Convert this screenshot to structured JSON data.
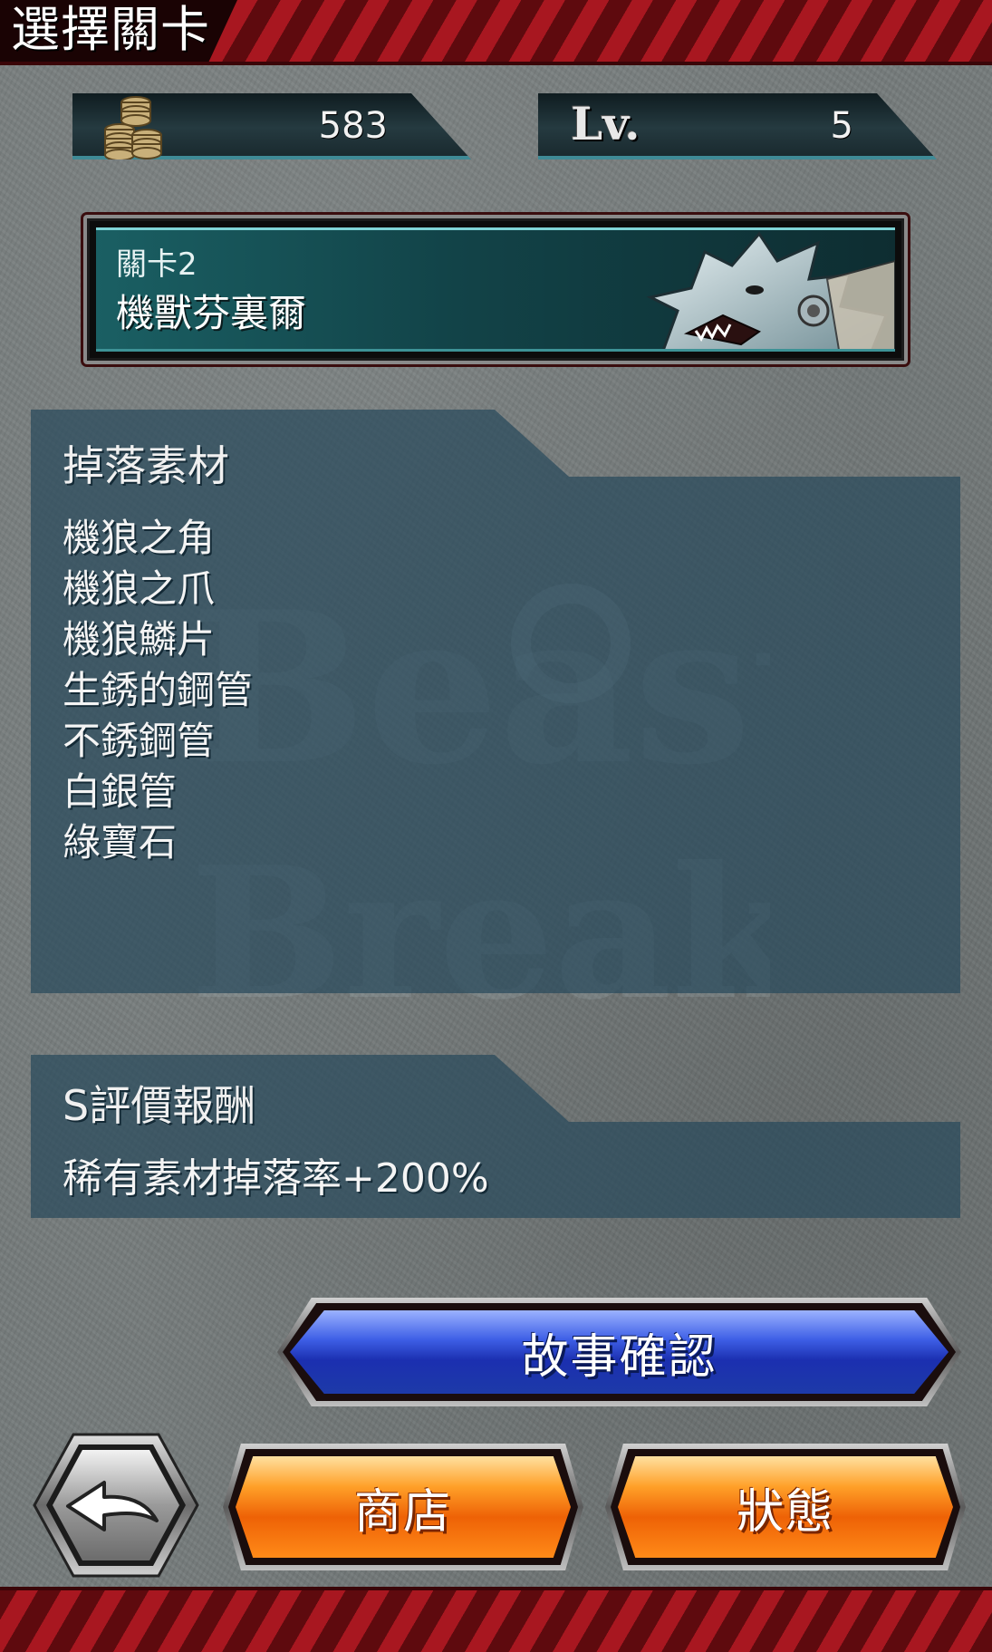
{
  "header": {
    "title": "選擇關卡"
  },
  "stats": {
    "coins": "583",
    "level_label": "Lv.",
    "level": "5"
  },
  "stage": {
    "number_label": "關卡2",
    "name": "機獸芬裏爾"
  },
  "drops": {
    "title": "掉落素材",
    "items": [
      "機狼之角",
      "機狼之爪",
      "機狼鱗片",
      "生銹的鋼管",
      "不銹鋼管",
      "白銀管",
      "綠寶石"
    ]
  },
  "reward": {
    "title": "S評價報酬",
    "text": "稀有素材掉落率+200%"
  },
  "buttons": {
    "story": "故事確認",
    "shop": "商店",
    "status": "狀態"
  },
  "icons": {
    "coins": "coin-stack-icon",
    "back": "back-arrow-icon",
    "boss": "wolf-boss-portrait"
  },
  "colors": {
    "header_red": "#a81720",
    "panel": "#284a5c",
    "story_blue": "#1b2fb0",
    "action_orange": "#ee6206"
  }
}
